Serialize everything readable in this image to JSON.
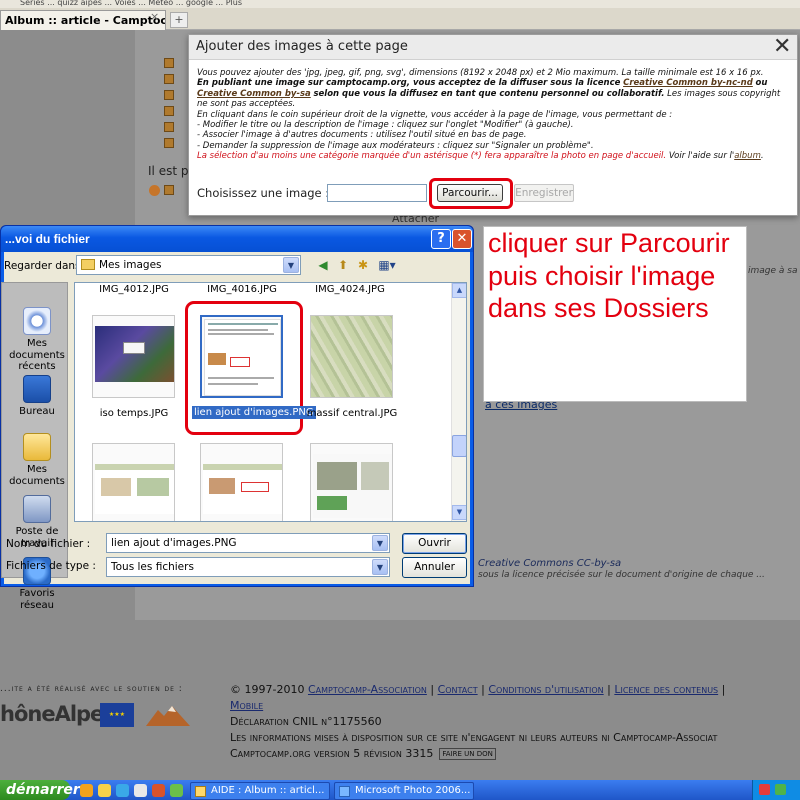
{
  "browser": {
    "bookmarks_text": "Séries   ...   quizz aipes   ...   Voies ...   Météo ...   google   ...   Plus",
    "tab_title": "Album :: article - Camptocamp...",
    "tab_close": "×",
    "newtab": "+"
  },
  "page": {
    "fragment_ilest": "Il est p",
    "links_fragment": "à ces images",
    "attacher_fragment": "Attacher",
    "cc_fragment": "Creative Commons CC-by-sa",
    "cc_note_fragment": "sous la licence précisée sur le document d'origine de chaque ...",
    "tail_fragment": "image à sa taill",
    "footer": {
      "left_text": "...ite a été réalisé avec le soutien de :",
      "rhone_logo": "hôneAlpes",
      "eu_logo": "★★★",
      "copyright": "© 1997-2010",
      "links": [
        "Camptocamp-Association",
        "Contact",
        "Conditions d'utilisation",
        "Licence des contenus",
        "Mobile"
      ],
      "separator": "|",
      "cnil": "Déclaration CNIL n°1175560",
      "disclaimer": "Les informations mises à disposition sur ce site n'engagent ni leurs auteurs ni Camptocamp-Associat",
      "version": "Camptocamp.org version 5 révision 3315",
      "don_badge": "FAIRE UN DON"
    }
  },
  "upload_panel": {
    "title": "Ajouter des images à cette page",
    "close_glyph": "✕",
    "info": {
      "line1": "Vous pouvez ajouter des 'jpg, jpeg, gif, png, svg', dimensions (8192 x 2048 px) et 2 Mio maximum. La taille minimale est 16 x 16 px.",
      "line2_bold": "En publiant une image sur camptocamp.org, vous acceptez de la diffuser sous la licence",
      "license1": "Creative Common by-nc-nd",
      "ou": "ou",
      "license2": "Creative Common by-sa",
      "line3_bold": "selon que vous la diffusez en tant que contenu personnel ou collaboratif.",
      "line3_rest": "Les images sous copyright ne sont pas acceptées.",
      "line4": "En cliquant dans le coin supérieur droit de la vignette, vous accéder à la page de l'image, vous permettant de :",
      "bullet1": "- Modifier le titre ou la description de l'image : cliquez sur l'onglet \"Modifier\" (à gauche).",
      "bullet2": "- Associer l'image à d'autres documents : utilisez l'outil situé en bas de page.",
      "bullet3": "- Demander la suppression de l'image aux modérateurs : cliquez sur \"Signaler un problème\".",
      "red_note": "La sélection d'au moins une catégorie marquée d'un astérisque (*) fera apparaître la photo en page d'accueil.",
      "help_prefix": "Voir l'aide sur l'",
      "help_link": "album",
      "help_suffix": "."
    },
    "choose_label": "Choisissez une image :",
    "file_path_value": "",
    "browse_button": "Parcourir...",
    "save_button": "Enregistrer"
  },
  "annotation": {
    "text": "cliquer sur Parcourir puis choisir l'image dans ses Dossiers"
  },
  "file_dialog": {
    "title": "...voi du fichier",
    "help_glyph": "?",
    "close_glyph": "✕",
    "look_in_label": "Regarder dans :",
    "look_in_value": "Mes images",
    "dropdown_glyph": "▼",
    "tools": [
      "◀",
      "⬆",
      "✱",
      "▦▾"
    ],
    "places": [
      {
        "label": "Mes documents récents",
        "icon": "recent-documents-icon"
      },
      {
        "label": "Bureau",
        "icon": "desktop-icon"
      },
      {
        "label": "Mes documents",
        "icon": "my-documents-icon"
      },
      {
        "label": "Poste de travail",
        "icon": "my-computer-icon"
      },
      {
        "label": "Favoris réseau",
        "icon": "network-places-icon"
      }
    ],
    "top_row_names": [
      "IMG_4012.JPG",
      "IMG_4016.JPG",
      "IMG_4024.JPG"
    ],
    "files": [
      {
        "name": "iso temps.JPG"
      },
      {
        "name": "lien ajout d'images.PNG",
        "selected": true
      },
      {
        "name": "massif central.JPG"
      }
    ],
    "scroll_up": "▲",
    "scroll_down": "▼",
    "file_name_label": "Nom du fichier :",
    "file_name_value": "lien ajout d'images.PNG",
    "file_type_label": "Fichiers de type :",
    "file_type_value": "Tous les fichiers",
    "open_button": "Ouvrir",
    "cancel_button": "Annuler"
  },
  "taskbar": {
    "start": "démarrer",
    "buttons": [
      "AIDE : Album :: articl...",
      "Microsoft Photo 2006..."
    ]
  },
  "colors": {
    "accent_red": "#e3000f",
    "xp_blue": "#0a5de8",
    "selection_blue": "#316ac5"
  }
}
